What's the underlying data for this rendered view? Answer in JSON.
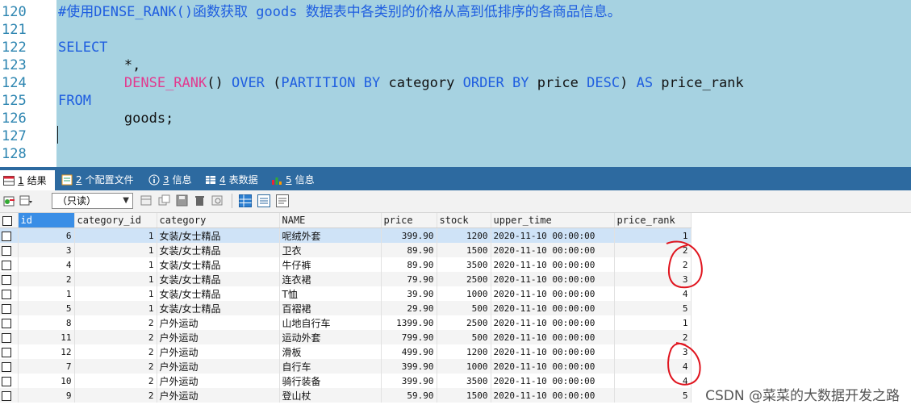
{
  "editor": {
    "lines": [
      {
        "num": "120",
        "parts": [
          {
            "t": "#使用DENSE_RANK()函数获取 goods 数据表中各类别的价格从高到低排序的各商品信息。",
            "c": "cm"
          }
        ]
      },
      {
        "num": "121",
        "parts": []
      },
      {
        "num": "122",
        "parts": [
          {
            "t": "SELECT",
            "c": "kw"
          }
        ]
      },
      {
        "num": "123",
        "parts": [
          {
            "t": "        *,",
            "c": "pn"
          }
        ]
      },
      {
        "num": "124",
        "parts": [
          {
            "t": "        ",
            "c": "pn"
          },
          {
            "t": "DENSE_RANK",
            "c": "fn"
          },
          {
            "t": "() ",
            "c": "pn"
          },
          {
            "t": "OVER",
            "c": "kw"
          },
          {
            "t": " (",
            "c": "pn"
          },
          {
            "t": "PARTITION BY",
            "c": "kw"
          },
          {
            "t": " category ",
            "c": "pn"
          },
          {
            "t": "ORDER BY",
            "c": "kw"
          },
          {
            "t": " price ",
            "c": "pn"
          },
          {
            "t": "DESC",
            "c": "kw"
          },
          {
            "t": ") ",
            "c": "pn"
          },
          {
            "t": "AS",
            "c": "kw"
          },
          {
            "t": " price_rank",
            "c": "pn"
          }
        ]
      },
      {
        "num": "125",
        "parts": [
          {
            "t": "FROM",
            "c": "kw"
          }
        ]
      },
      {
        "num": "126",
        "parts": [
          {
            "t": "        goods;",
            "c": "pn"
          }
        ]
      },
      {
        "num": "127",
        "parts": []
      },
      {
        "num": "128",
        "parts": []
      }
    ]
  },
  "tabs": [
    {
      "num": "1",
      "label": "结果",
      "icon": "result-grid-icon",
      "active": true
    },
    {
      "num": "2",
      "label": "个配置文件",
      "icon": "profile-icon",
      "active": false
    },
    {
      "num": "3",
      "label": "信息",
      "icon": "info-icon",
      "active": false
    },
    {
      "num": "4",
      "label": "表数据",
      "icon": "table-data-icon",
      "active": false
    },
    {
      "num": "5",
      "label": "信息",
      "icon": "info-chart-icon",
      "active": false
    }
  ],
  "toolbar": {
    "mode_value": "（只读）"
  },
  "grid": {
    "columns": [
      "id",
      "category_id",
      "category",
      "NAME",
      "price",
      "stock",
      "upper_time",
      "price_rank"
    ],
    "rows": [
      [
        "6",
        "1",
        "女装/女士精品",
        "呢绒外套",
        "399.90",
        "1200",
        "2020-11-10 00:00:00",
        "1"
      ],
      [
        "3",
        "1",
        "女装/女士精品",
        "卫衣",
        "89.90",
        "1500",
        "2020-11-10 00:00:00",
        "2"
      ],
      [
        "4",
        "1",
        "女装/女士精品",
        "牛仔裤",
        "89.90",
        "3500",
        "2020-11-10 00:00:00",
        "2"
      ],
      [
        "2",
        "1",
        "女装/女士精品",
        "连衣裙",
        "79.90",
        "2500",
        "2020-11-10 00:00:00",
        "3"
      ],
      [
        "1",
        "1",
        "女装/女士精品",
        "T恤",
        "39.90",
        "1000",
        "2020-11-10 00:00:00",
        "4"
      ],
      [
        "5",
        "1",
        "女装/女士精品",
        "百褶裙",
        "29.90",
        "500",
        "2020-11-10 00:00:00",
        "5"
      ],
      [
        "8",
        "2",
        "户外运动",
        "山地自行车",
        "1399.90",
        "2500",
        "2020-11-10 00:00:00",
        "1"
      ],
      [
        "11",
        "2",
        "户外运动",
        "运动外套",
        "799.90",
        "500",
        "2020-11-10 00:00:00",
        "2"
      ],
      [
        "12",
        "2",
        "户外运动",
        "滑板",
        "499.90",
        "1200",
        "2020-11-10 00:00:00",
        "3"
      ],
      [
        "7",
        "2",
        "户外运动",
        "自行车",
        "399.90",
        "1000",
        "2020-11-10 00:00:00",
        "4"
      ],
      [
        "10",
        "2",
        "户外运动",
        "骑行装备",
        "399.90",
        "3500",
        "2020-11-10 00:00:00",
        "4"
      ],
      [
        "9",
        "2",
        "户外运动",
        "登山杖",
        "59.90",
        "1500",
        "2020-11-10 00:00:00",
        "5"
      ]
    ]
  },
  "watermark": "CSDN @菜菜的大数据开发之路",
  "colors": {
    "editor_bg": "#a6d2e1",
    "keyword": "#1f5ee0",
    "function": "#e23a8f",
    "tabbar": "#2d6aa0",
    "annotation": "#e0141e"
  }
}
